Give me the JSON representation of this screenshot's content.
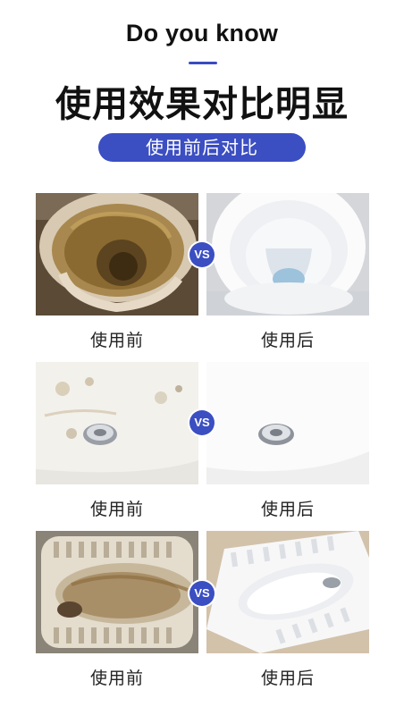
{
  "header": {
    "eyebrow": "Do you know",
    "headline": "使用效果对比明显",
    "pill": "使用前后对比"
  },
  "accent_color": "#3b4ec2",
  "comparisons": [
    {
      "before_label": "使用前",
      "after_label": "使用后",
      "vs_label": "VS",
      "subject": "toilet bowl"
    },
    {
      "before_label": "使用前",
      "after_label": "使用后",
      "vs_label": "VS",
      "subject": "washbasin drain"
    },
    {
      "before_label": "使用前",
      "after_label": "使用后",
      "vs_label": "VS",
      "subject": "squat toilet"
    }
  ]
}
